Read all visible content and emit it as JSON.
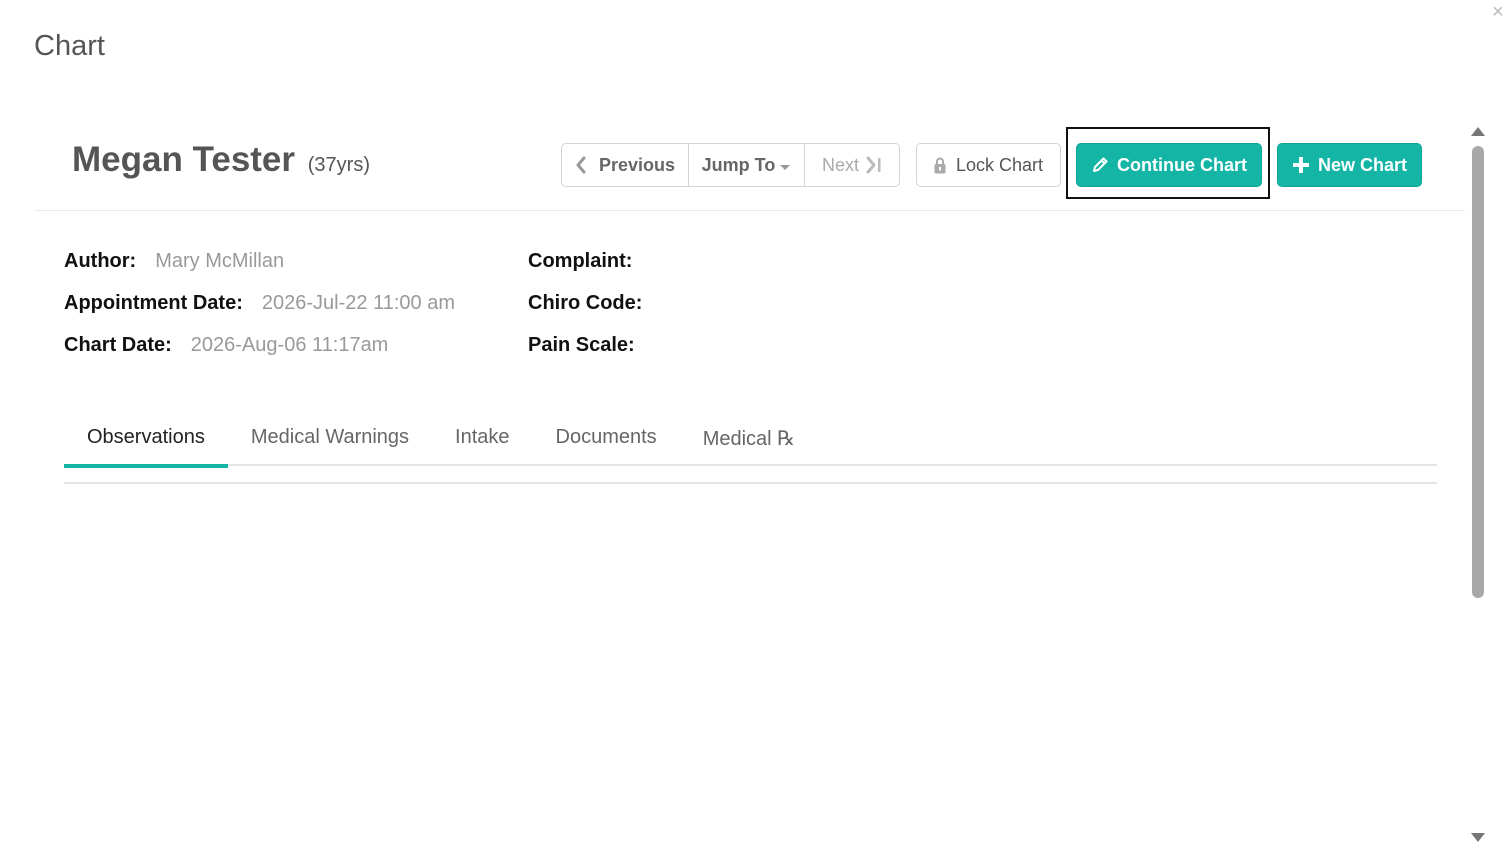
{
  "modal": {
    "title": "Chart",
    "close_glyph": "×"
  },
  "patient": {
    "name": "Megan Tester",
    "age": "(37yrs)"
  },
  "nav": {
    "previous_label": "Previous",
    "jump_to_label": "Jump To",
    "next_label": "Next"
  },
  "actions": {
    "lock_label": "Lock Chart",
    "continue_label": "Continue Chart",
    "new_label": "New Chart"
  },
  "info": {
    "author_label": "Author:",
    "author_value": "Mary McMillan",
    "appointment_label": "Appointment Date:",
    "appointment_value": "2026-Jul-22 11:00 am",
    "chart_date_label": "Chart Date:",
    "chart_date_value": "2026-Aug-06 11:17am",
    "complaint_label": "Complaint:",
    "chiro_code_label": "Chiro Code:",
    "pain_scale_label": "Pain Scale:"
  },
  "tabs": [
    {
      "label": "Observations",
      "active": true
    },
    {
      "label": "Medical Warnings",
      "active": false
    },
    {
      "label": "Intake",
      "active": false
    },
    {
      "label": "Documents",
      "active": false
    },
    {
      "label": "Medical ℞",
      "active": false
    }
  ],
  "colors": {
    "accent": "#15b5a6",
    "focus_frame": "#111111"
  },
  "icons": {
    "previous": "chevron-left-icon",
    "jump_to": "caret-down-icon",
    "next": "skip-next-icon",
    "lock": "lock-icon",
    "continue": "pencil-icon",
    "new": "plus-icon"
  }
}
